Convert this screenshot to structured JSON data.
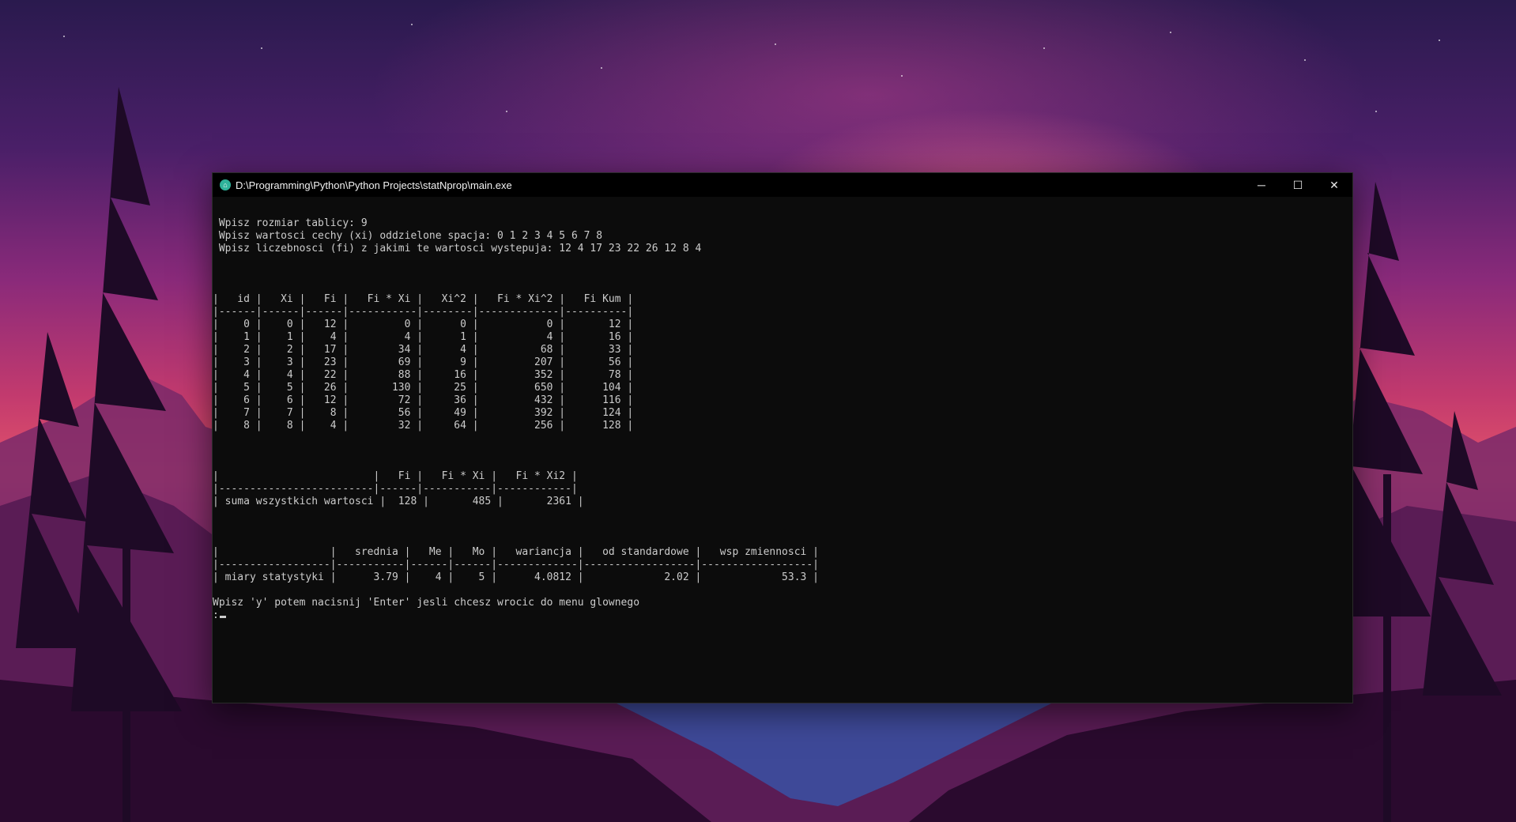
{
  "window": {
    "title": "D:\\Programming\\Python\\Python Projects\\statNprop\\main.exe",
    "app_icon": "console-app-icon",
    "controls": {
      "minimize": "─",
      "maximize": "☐",
      "close": "✕"
    }
  },
  "prompts": [
    "",
    " Wpisz rozmiar tablicy: 9",
    " Wpisz wartosci cechy (xi) oddzielone spacja: 0 1 2 3 4 5 6 7 8",
    " Wpisz liczebnosci (fi) z jakimi te wartosci wystepuja: 12 4 17 23 22 26 12 8 4",
    "",
    "",
    "",
    "|   id |   Xi |   Fi |   Fi * Xi |   Xi^2 |   Fi * Xi^2 |   Fi Kum |",
    "|------|------|------|-----------|--------|-------------|----------|",
    "|    0 |    0 |   12 |         0 |      0 |           0 |       12 |",
    "|    1 |    1 |    4 |         4 |      1 |           4 |       16 |",
    "|    2 |    2 |   17 |        34 |      4 |          68 |       33 |",
    "|    3 |    3 |   23 |        69 |      9 |         207 |       56 |",
    "|    4 |    4 |   22 |        88 |     16 |         352 |       78 |",
    "|    5 |    5 |   26 |       130 |     25 |         650 |      104 |",
    "|    6 |    6 |   12 |        72 |     36 |         432 |      116 |",
    "|    7 |    7 |    8 |        56 |     49 |         392 |      124 |",
    "|    8 |    8 |    4 |        32 |     64 |         256 |      128 |",
    "",
    "",
    "",
    "|                         |   Fi |   Fi * Xi |   Fi * Xi2 |",
    "|-------------------------|------|-----------|------------|",
    "| suma wszystkich wartosci |  128 |       485 |       2361 |",
    "",
    "",
    "",
    "|                  |   srednia |   Me |   Mo |   wariancja |   od standardowe |   wsp zmiennosci |",
    "|------------------|-----------|------|------|-------------|------------------|------------------|",
    "| miary statystyki |      3.79 |    4 |    5 |      4.0812 |             2.02 |             53.3 |",
    "",
    "Wpisz 'y' potem nacisnij 'Enter' jesli chcesz wrocic do menu glownego"
  ],
  "input_prompt": ":"
}
